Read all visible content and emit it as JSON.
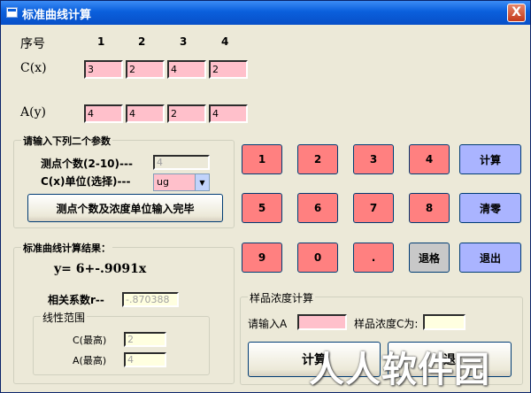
{
  "window": {
    "title": "标准曲线计算",
    "close_label": "X"
  },
  "table": {
    "header_label": "序号",
    "columns": [
      "1",
      "2",
      "3",
      "4"
    ],
    "c_label": "C(x)",
    "c_values": [
      "3",
      "2",
      "4",
      "2"
    ],
    "a_label": "A(y)",
    "a_values": [
      "4",
      "4",
      "2",
      "4"
    ]
  },
  "params": {
    "title": "请输入下列二个参数",
    "count_label": "测点个数(2-10)---",
    "count_value": "4",
    "unit_label": "C(x)单位(选择)---",
    "unit_value": "ug",
    "confirm_button": "测点个数及浓度单位输入完毕"
  },
  "result": {
    "title": "标准曲线计算结果：",
    "equation": "y=  6+-.9091x",
    "corr_label": "相关系数r--",
    "corr_value": "-.870388",
    "range_title": "线性范围",
    "c_max_label": "C(最高)",
    "c_max_value": "2",
    "a_max_label": "A(最高)",
    "a_max_value": "4"
  },
  "keypad": {
    "keys": [
      "1",
      "2",
      "3",
      "4",
      "5",
      "6",
      "7",
      "8",
      "9",
      "0",
      "."
    ],
    "compute": "计算",
    "clear": "清零",
    "backspace": "退格",
    "exit": "退出"
  },
  "sample": {
    "title": "样品浓度计算",
    "input_label": "请输入A",
    "input_value": "",
    "result_label": "样品浓度C为:",
    "result_value": "",
    "compute_button": "计算",
    "second_button": "退"
  },
  "watermark": "人人软件园",
  "colors": {
    "key_pink": "#ff8080",
    "key_blue": "#aab4ff",
    "field_pink": "#ffc0cb",
    "field_yellow": "#ffffe0"
  }
}
